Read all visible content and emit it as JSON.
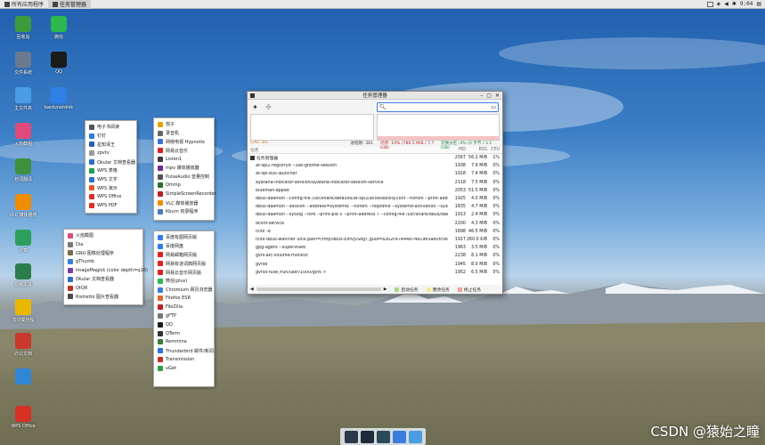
{
  "top_panel": {
    "launcher_label": "所有应用程序",
    "active_task_label": "任务管理器",
    "clock": "9:04"
  },
  "desktop": {
    "icons": [
      {
        "label": "回收站",
        "icon": "trash-icon",
        "color": "#3d9a3d"
      },
      {
        "label": "微信",
        "icon": "wechat-icon",
        "color": "#2db84d"
      },
      {
        "label": "文件系统",
        "icon": "drive-icon",
        "color": "#6b7a8f"
      },
      {
        "label": "QQ",
        "icon": "qq-penguin-icon",
        "color": "#1a1a1a"
      },
      {
        "label": "主文件夹",
        "icon": "home-folder-icon",
        "color": "#4a9de0"
      },
      {
        "label": "baidunetdisk",
        "icon": "baidu-cloud-icon",
        "color": "#2f7fe8"
      },
      {
        "label": "火焰截图",
        "icon": "flameshot-icon",
        "color": "#e04a7a"
      },
      {
        "label": "划词翻译",
        "icon": "translate-icon",
        "color": "#3f8f3f"
      },
      {
        "label": "VLC 媒体播放",
        "icon": "vlc-cone-icon",
        "color": "#f08c00"
      },
      {
        "label": "计算",
        "icon": "calculator-icon",
        "color": "#2e9e5e"
      },
      {
        "label": "视频工具",
        "icon": "video-tool-icon",
        "color": "#2b7d4b"
      },
      {
        "label": "向日葵远程",
        "icon": "sunflower-icon",
        "color": "#e8b800"
      },
      {
        "label": "办公文档",
        "icon": "office-doc-icon",
        "color": "#c8392b"
      },
      {
        "label": "",
        "icon": "chrome-icon",
        "color": "#2f86d6"
      },
      {
        "label": "WPS Office",
        "icon": "wps-icon",
        "color": "#d93025"
      }
    ]
  },
  "menus": {
    "office": [
      {
        "label": "电子书阅读",
        "icon": "ebook-icon",
        "color": "#555"
      },
      {
        "label": "钉钉",
        "icon": "dingtalk-icon",
        "color": "#2a7de1"
      },
      {
        "label": "星知译王",
        "icon": "dict-icon",
        "color": "#2b5fb3"
      },
      {
        "label": "zpvtv",
        "icon": "zpvtv-icon",
        "color": "#999"
      },
      {
        "label": "Okular 文档查看器",
        "icon": "okular-icon",
        "color": "#2e6ec0"
      },
      {
        "label": "WPS 表格",
        "icon": "wps-sheet-icon",
        "color": "#1f9d55"
      },
      {
        "label": "WPS 文字",
        "icon": "wps-writer-icon",
        "color": "#2f6fd6"
      },
      {
        "label": "WPS 演示",
        "icon": "wps-present-icon",
        "color": "#e0592b"
      },
      {
        "label": "WPS Office",
        "icon": "wps-office-icon",
        "color": "#d93025"
      },
      {
        "label": "WPS PDF",
        "icon": "wps-pdf-icon",
        "color": "#d93025"
      }
    ],
    "media": [
      {
        "label": "茄子",
        "icon": "cheese-icon",
        "color": "#e8a000"
      },
      {
        "label": "录音机",
        "icon": "recorder-icon",
        "color": "#666"
      },
      {
        "label": "网络电视 Hypnotix",
        "icon": "tv-icon",
        "color": "#3b6fd6"
      },
      {
        "label": "网易云音乐",
        "icon": "netease-music-icon",
        "color": "#d22"
      },
      {
        "label": "Listen1",
        "icon": "listen1-icon",
        "color": "#3a3a3a"
      },
      {
        "label": "mpv 媒体播放器",
        "icon": "mpv-icon",
        "color": "#6a2c91"
      },
      {
        "label": "PulseAudio 音量控制",
        "icon": "volume-icon",
        "color": "#555"
      },
      {
        "label": "Qmmp",
        "icon": "qmmp-icon",
        "color": "#2d6e2d"
      },
      {
        "label": "SimpleScreenRecorder",
        "icon": "screen-recorder-icon",
        "color": "#b22"
      },
      {
        "label": "VLC 媒体播放器",
        "icon": "vlc-icon",
        "color": "#f08c00"
      },
      {
        "label": "Kburn 刻录程序",
        "icon": "burn-icon",
        "color": "#4a7ab8"
      }
    ],
    "graphics": [
      {
        "label": "火焰截图",
        "icon": "flameshot-icon",
        "color": "#e04a7a"
      },
      {
        "label": "Dia",
        "icon": "dia-icon",
        "color": "#777"
      },
      {
        "label": "GNU 图像处理程序",
        "icon": "gimp-icon",
        "color": "#7a6a4a"
      },
      {
        "label": "gThumb",
        "icon": "gthumb-icon",
        "color": "#3b7ddd"
      },
      {
        "label": "ImageMagick (color depth=q16)",
        "icon": "imagemagick-icon",
        "color": "#7b3fa0"
      },
      {
        "label": "Okular 文档查看器",
        "icon": "okular-icon",
        "color": "#2e6ec0"
      },
      {
        "label": "QtQR",
        "icon": "qr-icon",
        "color": "#c03020"
      },
      {
        "label": "Ristretto 图片查看器",
        "icon": "ristretto-icon",
        "color": "#4a4a4a"
      }
    ],
    "internet": [
      {
        "label": "百度有图网页版",
        "icon": "baidu-icon",
        "color": "#2f7fe8"
      },
      {
        "label": "百度网盘",
        "icon": "baidu-netdisk-icon",
        "color": "#2f7fe8"
      },
      {
        "label": "网易邮箱网页版",
        "icon": "netease-mail-icon",
        "color": "#d22"
      },
      {
        "label": "网易有道词典网页版",
        "icon": "youdao-icon",
        "color": "#d22"
      },
      {
        "label": "网易云音乐网页版",
        "icon": "netease-web-icon",
        "color": "#d22"
      },
      {
        "label": "微信(plus)",
        "icon": "wechat-plus-icon",
        "color": "#2db84d"
      },
      {
        "label": "Chromium 网页浏览器",
        "icon": "chromium-icon",
        "color": "#3b7ddd"
      },
      {
        "label": "Firefox ESR",
        "icon": "firefox-icon",
        "color": "#e0662a"
      },
      {
        "label": "FileZilla",
        "icon": "filezilla-icon",
        "color": "#b22"
      },
      {
        "label": "gFTP",
        "icon": "gftp-icon",
        "color": "#777"
      },
      {
        "label": "QQ",
        "icon": "qq-icon",
        "color": "#1a1a1a"
      },
      {
        "label": "QTerm",
        "icon": "qterm-icon",
        "color": "#333"
      },
      {
        "label": "Remmina",
        "icon": "remmina-icon",
        "color": "#3a7a3a"
      },
      {
        "label": "Thunderbird 邮件/新闻",
        "icon": "thunderbird-icon",
        "color": "#2f6fd6"
      },
      {
        "label": "Transmission",
        "icon": "transmission-icon",
        "color": "#c03020"
      },
      {
        "label": "uGet",
        "icon": "uget-icon",
        "color": "#2f9e4f"
      }
    ]
  },
  "task_manager": {
    "title": "任务管理器",
    "search_placeholder": "",
    "stats": {
      "cpu": "CPU: 3%",
      "processes": "进程数: 381",
      "memory": "内存: 10% (780.5 MiB / 7.7 GiB)",
      "swap": "交换分区: 0% (0 字节 / 3.1 GiB)"
    },
    "columns": {
      "name": "任务",
      "pid": "PID",
      "mem": "RSS",
      "cpu": "CPU"
    },
    "root_label": "任务管理器",
    "root_pid": "2567",
    "root_mem": "56.2 MiB",
    "root_cpu": "1%",
    "processes": [
      {
        "name": "at-spi2-registryd --use-gnome-session",
        "pid": "1938",
        "mem": "7.9 MiB",
        "cpu": "0%"
      },
      {
        "name": "at-spi-bus-launcher",
        "pid": "1918",
        "mem": "7.4 MiB",
        "cpu": "0%"
      },
      {
        "name": "ayatana-indicator-session/ayatana-indicator-session-service",
        "pid": "2118",
        "mem": "7.5 MiB",
        "cpu": "0%"
      },
      {
        "name": "blueman-applet",
        "pid": "2053",
        "mem": "51.5 MiB",
        "cpu": "0%"
      },
      {
        "name": "dbus-daemon --config-file /usr/share/defaults/at-spi2/accessibility.conf --nofork --print-address 1...",
        "pid": "1925",
        "mem": "4.0 MiB",
        "cpu": "0%"
      },
      {
        "name": "dbus-daemon --session --address=systemd: --nofork --nopidfile --systemd-activation --syslog-only",
        "pid": "1835",
        "mem": "4.7 MiB",
        "cpu": "0%"
      },
      {
        "name": "dbus-daemon --syslog --fork --print-pid 5 --print-address 7 --config-file /usr/share/dbus/dae...",
        "pid": "1913",
        "mem": "2.4 MiB",
        "cpu": "0%"
      },
      {
        "name": "dconf-service",
        "pid": "2200",
        "mem": "4.3 MiB",
        "cpu": "0%"
      },
      {
        "name": "fcitx -d",
        "pid": "1898",
        "mem": "46.5 MiB",
        "cpu": "0%"
      },
      {
        "name": "fcitx-dbus-watcher unix:path=/tmp/dbus-Exfvj5S8gT,guid=a302c47e4487481965ad0fc06779d998 1913",
        "pid": "1917",
        "mem": "260.0 KiB",
        "cpu": "0%"
      },
      {
        "name": "gpg-agent --supervised",
        "pid": "1963",
        "mem": "3.5 MiB",
        "cpu": "0%"
      },
      {
        "name": "gvfs-afc-volume-monitor",
        "pid": "2238",
        "mem": "8.1 MiB",
        "cpu": "0%"
      },
      {
        "name": "gvfsd",
        "pid": "1945",
        "mem": "8.0 MiB",
        "cpu": "0%"
      },
      {
        "name": "gvfsd-fuse /run/user/1000/gvfs -f",
        "pid": "1952",
        "mem": "6.5 MiB",
        "cpu": "0%"
      }
    ],
    "legend": {
      "starting": "启动任务",
      "changing": "更改任务",
      "terminating": "终止任务"
    },
    "legend_colors": {
      "starting": "#a8d88a",
      "changing": "#f2ee8a",
      "terminating": "#f2a0a0"
    }
  },
  "dock": {
    "items": [
      {
        "icon": "show-desktop-icon",
        "color": "#2a3a4a"
      },
      {
        "icon": "terminal-icon",
        "color": "#1f2b38"
      },
      {
        "icon": "task-manager-icon",
        "color": "#2b4a5a"
      },
      {
        "icon": "search-icon",
        "color": "#3b7ddd"
      },
      {
        "icon": "file-manager-icon",
        "color": "#4a9de0"
      }
    ]
  },
  "watermark": "CSDN @猿始之瞳"
}
